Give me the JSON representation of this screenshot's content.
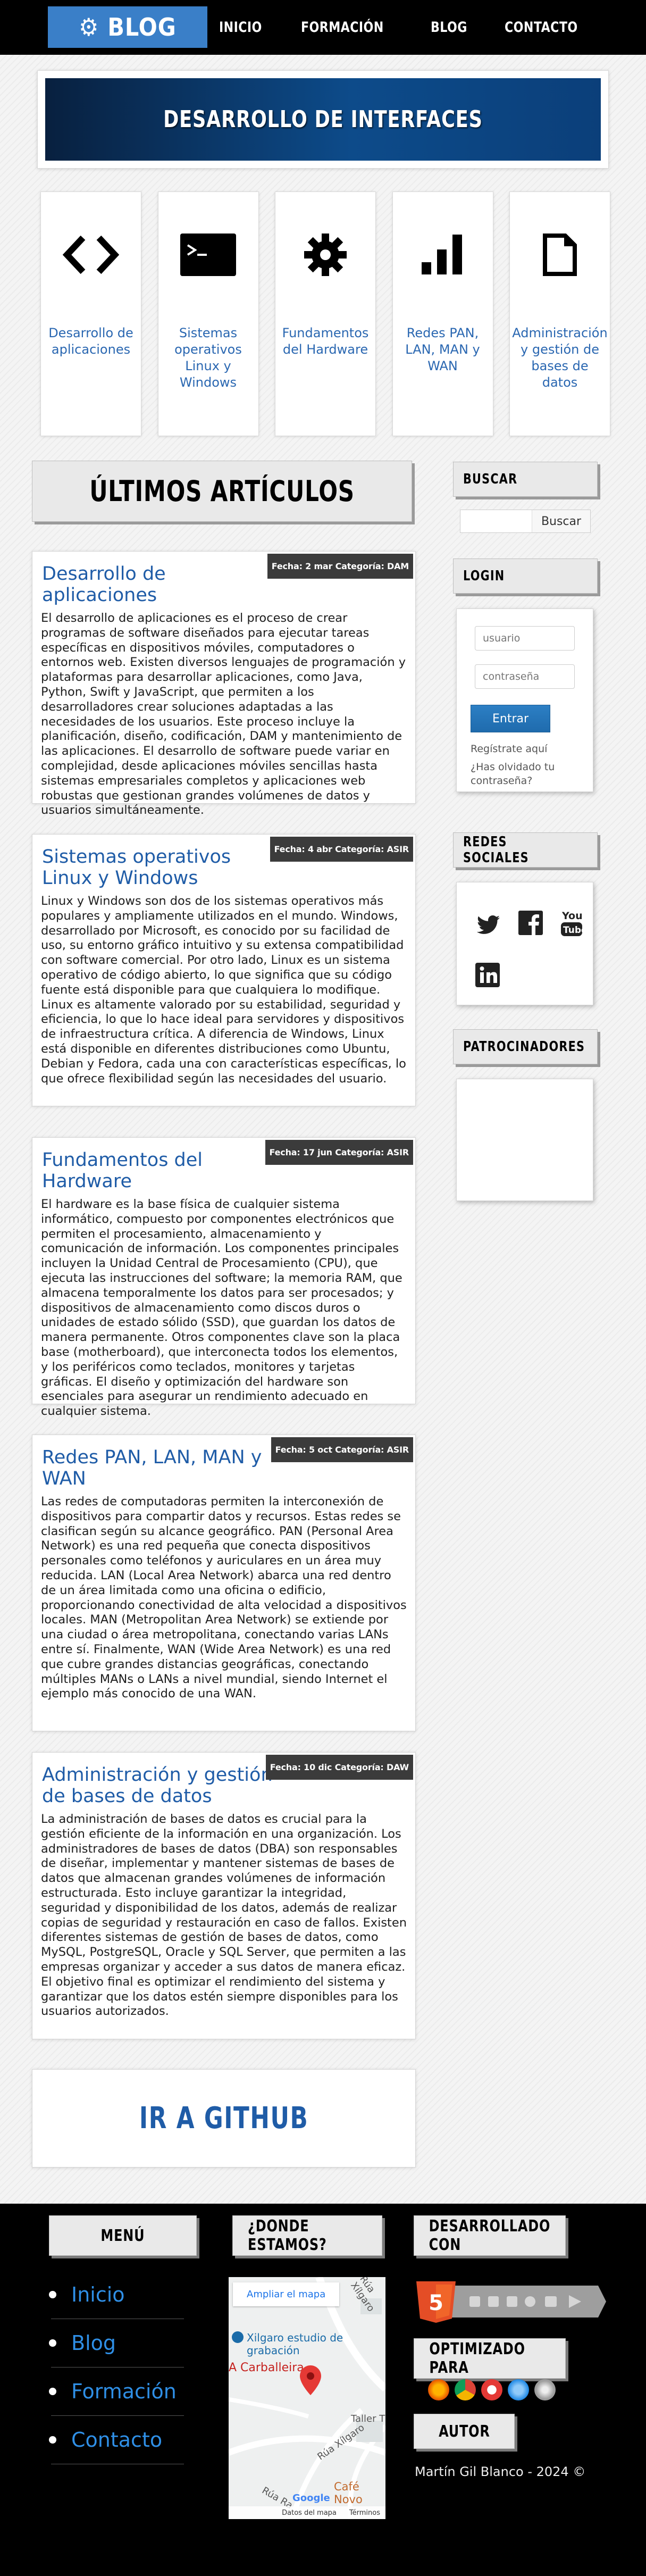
{
  "header": {
    "brand": "BLOG",
    "nav": [
      "INICIO",
      "FORMACIÓN",
      "BLOG",
      "CONTACTO"
    ]
  },
  "hero": {
    "title": "DESARROLLO DE INTERFACES"
  },
  "categories": [
    {
      "label": "Desarrollo de aplicaciones",
      "icon": "code-icon"
    },
    {
      "label": "Sistemas operativos Linux y Windows",
      "icon": "terminal-icon"
    },
    {
      "label": "Fundamentos del Hardware",
      "icon": "gear-icon"
    },
    {
      "label": "Redes PAN, LAN, MAN y WAN",
      "icon": "signal-bars-icon"
    },
    {
      "label": "Administración y gestión de bases de datos",
      "icon": "document-icon"
    }
  ],
  "main": {
    "section_title": "ÚLTIMOS ARTÍCULOS",
    "articles": [
      {
        "title": "Desarrollo de aplicaciones",
        "meta": "Fecha: 2 mar Categoría: DAM",
        "body": "El desarrollo de aplicaciones es el proceso de crear programas de software diseñados para ejecutar tareas específicas en dispositivos móviles, computadores o entornos web. Existen diversos lenguajes de programación y plataformas para desarrollar aplicaciones, como Java, Python, Swift y JavaScript, que permiten a los desarrolladores crear soluciones adaptadas a las necesidades de los usuarios. Este proceso incluye la planificación, diseño, codificación, DAM y mantenimiento de las aplicaciones. El desarrollo de software puede variar en complejidad, desde aplicaciones móviles sencillas hasta sistemas empresariales completos y aplicaciones web robustas que gestionan grandes volúmenes de datos y usuarios simultáneamente."
      },
      {
        "title": "Sistemas operativos Linux y Windows",
        "meta": "Fecha: 4 abr Categoría: ASIR",
        "body": "Linux y Windows son dos de los sistemas operativos más populares y ampliamente utilizados en el mundo. Windows, desarrollado por Microsoft, es conocido por su facilidad de uso, su entorno gráfico intuitivo y su extensa compatibilidad con software comercial. Por otro lado, Linux es un sistema operativo de código abierto, lo que significa que su código fuente está disponible para que cualquiera lo modifique. Linux es altamente valorado por su estabilidad, seguridad y eficiencia, lo que lo hace ideal para servidores y dispositivos de infraestructura crítica. A diferencia de Windows, Linux está disponible en diferentes distribuciones como Ubuntu, Debian y Fedora, cada una con características específicas, lo que ofrece flexibilidad según las necesidades del usuario."
      },
      {
        "title": "Fundamentos del Hardware",
        "meta": "Fecha: 17 jun Categoría: ASIR",
        "body": "El hardware es la base física de cualquier sistema informático, compuesto por componentes electrónicos que permiten el procesamiento, almacenamiento y comunicación de información. Los componentes principales incluyen la Unidad Central de Procesamiento (CPU), que ejecuta las instrucciones del software; la memoria RAM, que almacena temporalmente los datos para ser procesados; y dispositivos de almacenamiento como discos duros o unidades de estado sólido (SSD), que guardan los datos de manera permanente. Otros componentes clave son la placa base (motherboard), que interconecta todos los elementos, y los periféricos como teclados, monitores y tarjetas gráficas. El diseño y optimización del hardware son esenciales para asegurar un rendimiento adecuado en cualquier sistema."
      },
      {
        "title": "Redes PAN, LAN, MAN y WAN",
        "meta": "Fecha: 5 oct Categoría: ASIR",
        "body": "Las redes de computadoras permiten la interconexión de dispositivos para compartir datos y recursos. Estas redes se clasifican según su alcance geográfico. PAN (Personal Area Network) es una red pequeña que conecta dispositivos personales como teléfonos y auriculares en un área muy reducida. LAN (Local Area Network) abarca una red dentro de un área limitada como una oficina o edificio, proporcionando conectividad de alta velocidad a dispositivos locales. MAN (Metropolitan Area Network) se extiende por una ciudad o área metropolitana, conectando varias LANs entre sí. Finalmente, WAN (Wide Area Network) es una red que cubre grandes distancias geográficas, conectando múltiples MANs o LANs a nivel mundial, siendo Internet el ejemplo más conocido de una WAN."
      },
      {
        "title": "Administración y gestión de bases de datos",
        "meta": "Fecha: 10 dic Categoría: DAW",
        "body": "La administración de bases de datos es crucial para la gestión eficiente de la información en una organización. Los administradores de bases de datos (DBA) son responsables de diseñar, implementar y mantener sistemas de bases de datos que almacenan grandes volúmenes de información estructurada. Esto incluye garantizar la integridad, seguridad y disponibilidad de los datos, además de realizar copias de seguridad y restauración en caso de fallos. Existen diferentes sistemas de gestión de bases de datos, como MySQL, PostgreSQL, Oracle y SQL Server, que permiten a las empresas organizar y acceder a sus datos de manera eficaz. El objetivo final es optimizar el rendimiento del sistema y garantizar que los datos estén siempre disponibles para los usuarios autorizados."
      }
    ],
    "github": "IR A GITHUB"
  },
  "sidebar": {
    "search": {
      "title": "BUSCAR",
      "button": "Buscar",
      "placeholder": ""
    },
    "login": {
      "title": "LOGIN",
      "user_placeholder": "usuario",
      "pass_placeholder": "contraseña",
      "button": "Entrar",
      "register": "Regístrate aquí",
      "forgot": "¿Has olvidado tu contraseña?"
    },
    "social": {
      "title": "REDES SOCIALES",
      "icons": [
        "twitter-icon",
        "facebook-icon",
        "youtube-icon",
        "linkedin-icon"
      ]
    },
    "sponsors": {
      "title": "PATROCINADORES"
    }
  },
  "footer": {
    "menu_title": "MENÚ",
    "menu": [
      "Inicio",
      "Blog",
      "Formación",
      "Contacto"
    ],
    "where_title": "¿DONDE ESTAMOS?",
    "map": {
      "enlarge": "Ampliar el mapa",
      "place": "Xilgaro estudio de grabación",
      "area": "A Carballeira",
      "place2": "Café Novo",
      "roads": [
        "Rúa Xílgaro",
        "Rúa Ra",
        "Rúa Xílgaro",
        "Taller T"
      ],
      "attrib": [
        "Datos del mapa",
        "Términos"
      ],
      "brand": "Google"
    },
    "dev_title": "DESARROLLADO CON",
    "opt_title": "OPTIMIZADO PARA",
    "author_title": "AUTOR",
    "author": "Martín Gil Blanco - 2024 ©"
  },
  "colors": {
    "accent": "#3a7fc8",
    "link": "#1f5ca7",
    "footer_link": "#2f8fe6"
  }
}
